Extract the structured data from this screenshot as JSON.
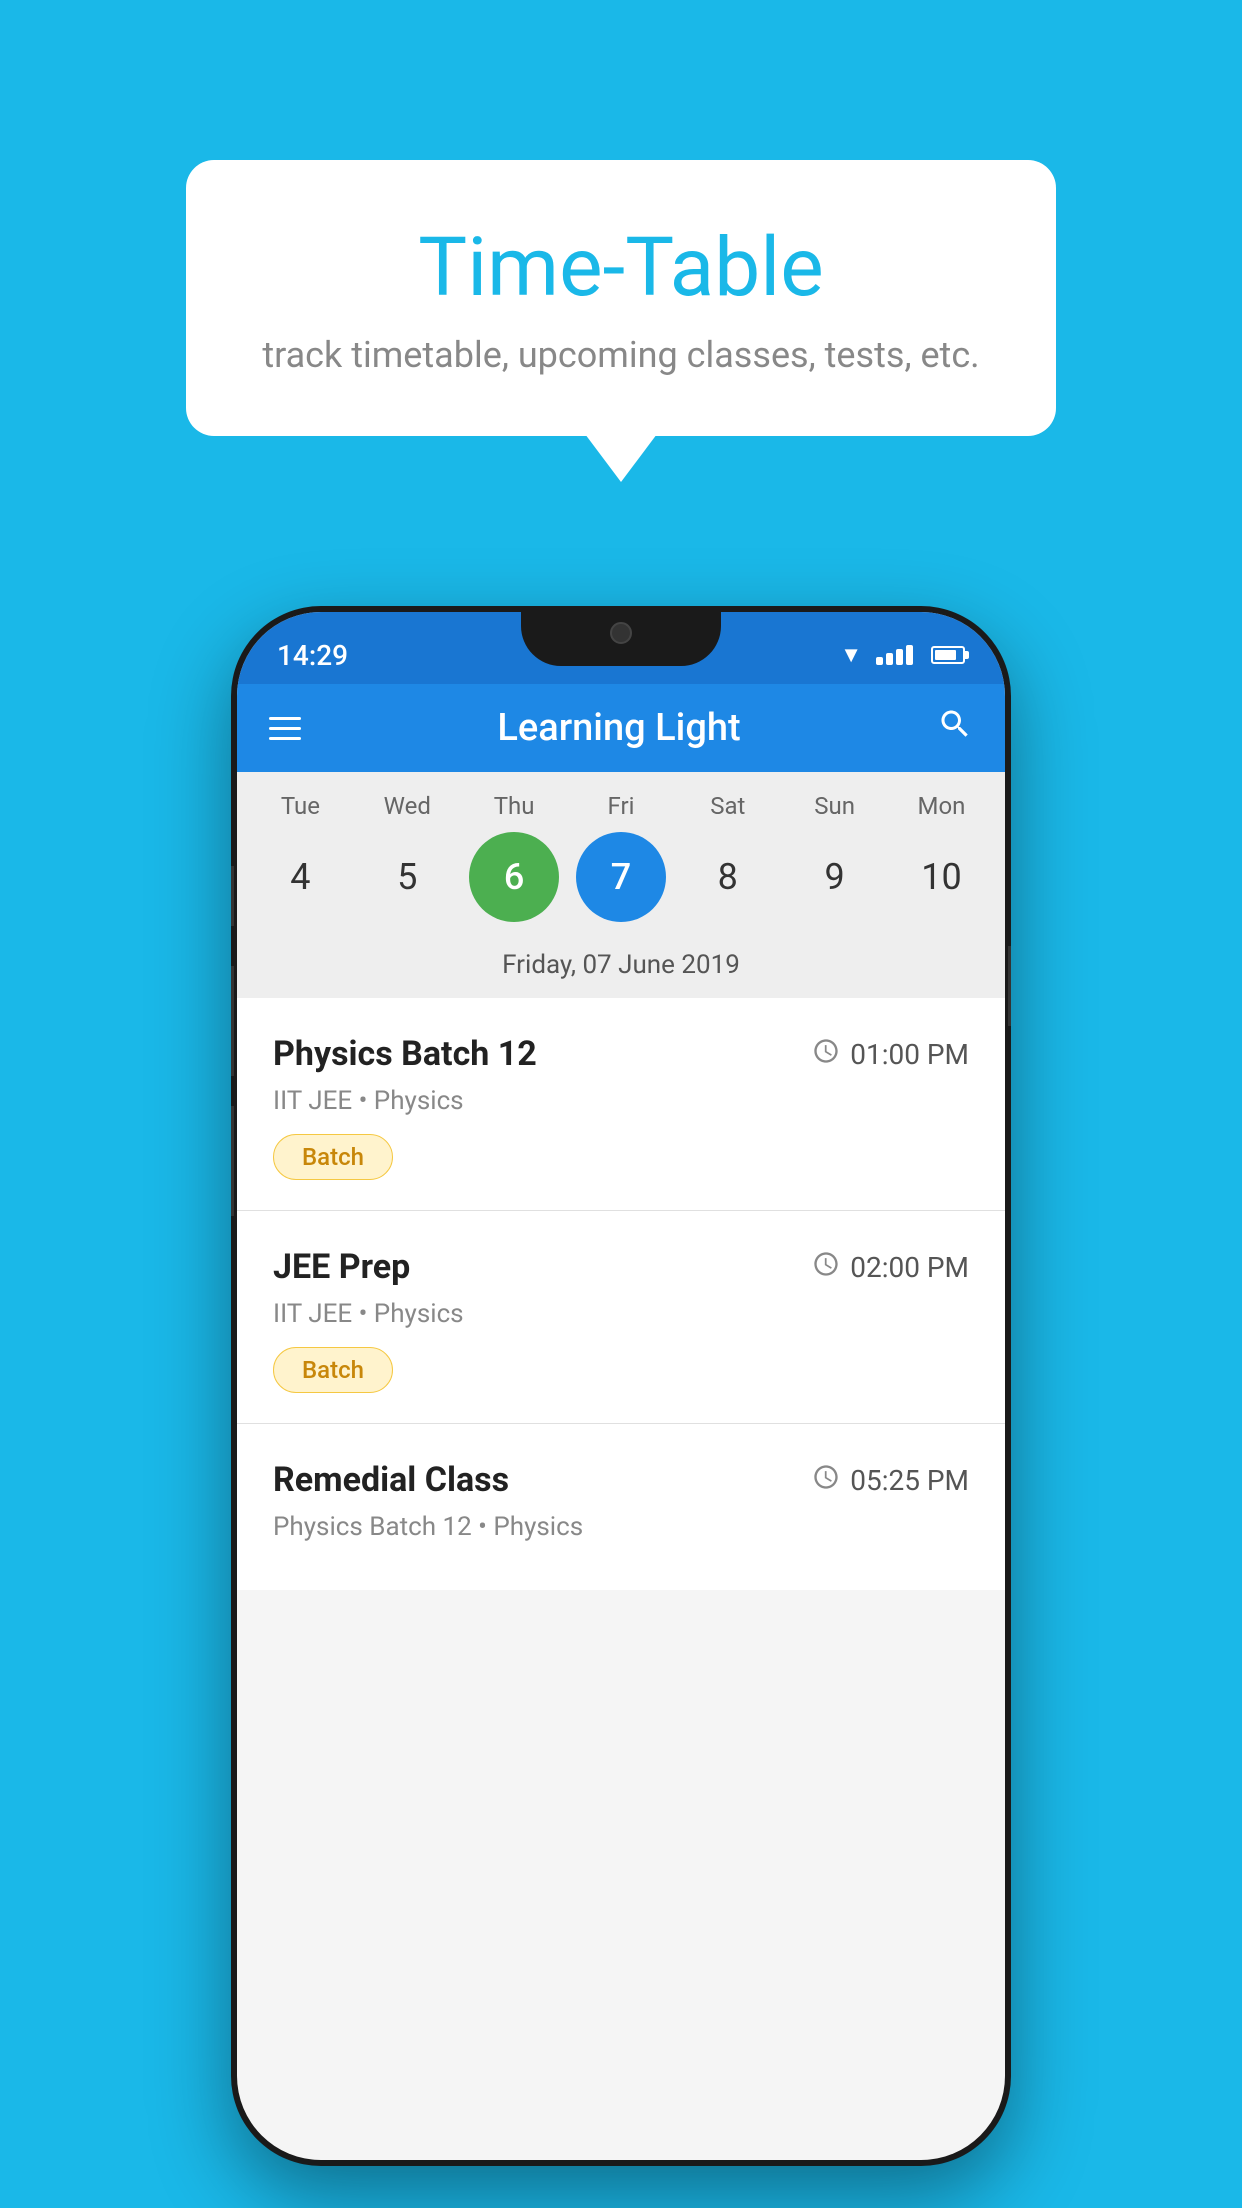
{
  "background_color": "#1ab8e8",
  "speech_bubble": {
    "title": "Time-Table",
    "subtitle": "track timetable, upcoming classes, tests, etc."
  },
  "phone": {
    "status_bar": {
      "time": "14:29"
    },
    "app_header": {
      "title": "Learning Light"
    },
    "calendar": {
      "day_headers": [
        "Tue",
        "Wed",
        "Thu",
        "Fri",
        "Sat",
        "Sun",
        "Mon"
      ],
      "day_numbers": [
        {
          "num": "4",
          "state": "normal"
        },
        {
          "num": "5",
          "state": "normal"
        },
        {
          "num": "6",
          "state": "today"
        },
        {
          "num": "7",
          "state": "selected"
        },
        {
          "num": "8",
          "state": "normal"
        },
        {
          "num": "9",
          "state": "normal"
        },
        {
          "num": "10",
          "state": "normal"
        }
      ],
      "selected_date_label": "Friday, 07 June 2019"
    },
    "schedule": [
      {
        "title": "Physics Batch 12",
        "time": "01:00 PM",
        "subtitle": "IIT JEE • Physics",
        "badge": "Batch"
      },
      {
        "title": "JEE Prep",
        "time": "02:00 PM",
        "subtitle": "IIT JEE • Physics",
        "badge": "Batch"
      },
      {
        "title": "Remedial Class",
        "time": "05:25 PM",
        "subtitle": "Physics Batch 12 • Physics",
        "badge": null
      }
    ]
  }
}
